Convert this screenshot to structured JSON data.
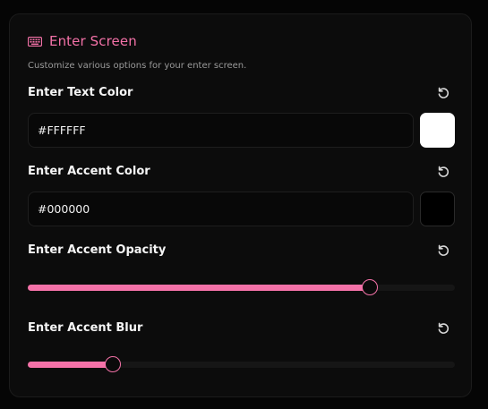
{
  "section": {
    "title": "Enter Screen",
    "subtitle": "Customize various options for your enter screen.",
    "icon": "keyboard-icon"
  },
  "colors": {
    "accent": "#f472a8",
    "panel_bg": "#0c0c0c"
  },
  "text_color": {
    "label": "Enter Text Color",
    "value": "#FFFFFF",
    "swatch": "#FFFFFF"
  },
  "accent_color": {
    "label": "Enter Accent Color",
    "value": "#000000",
    "swatch": "#000000"
  },
  "accent_opacity": {
    "label": "Enter Accent Opacity",
    "value_fraction": 0.8
  },
  "accent_blur": {
    "label": "Enter Accent Blur",
    "value_fraction": 0.2
  },
  "icons": {
    "reset": "reset-icon"
  }
}
